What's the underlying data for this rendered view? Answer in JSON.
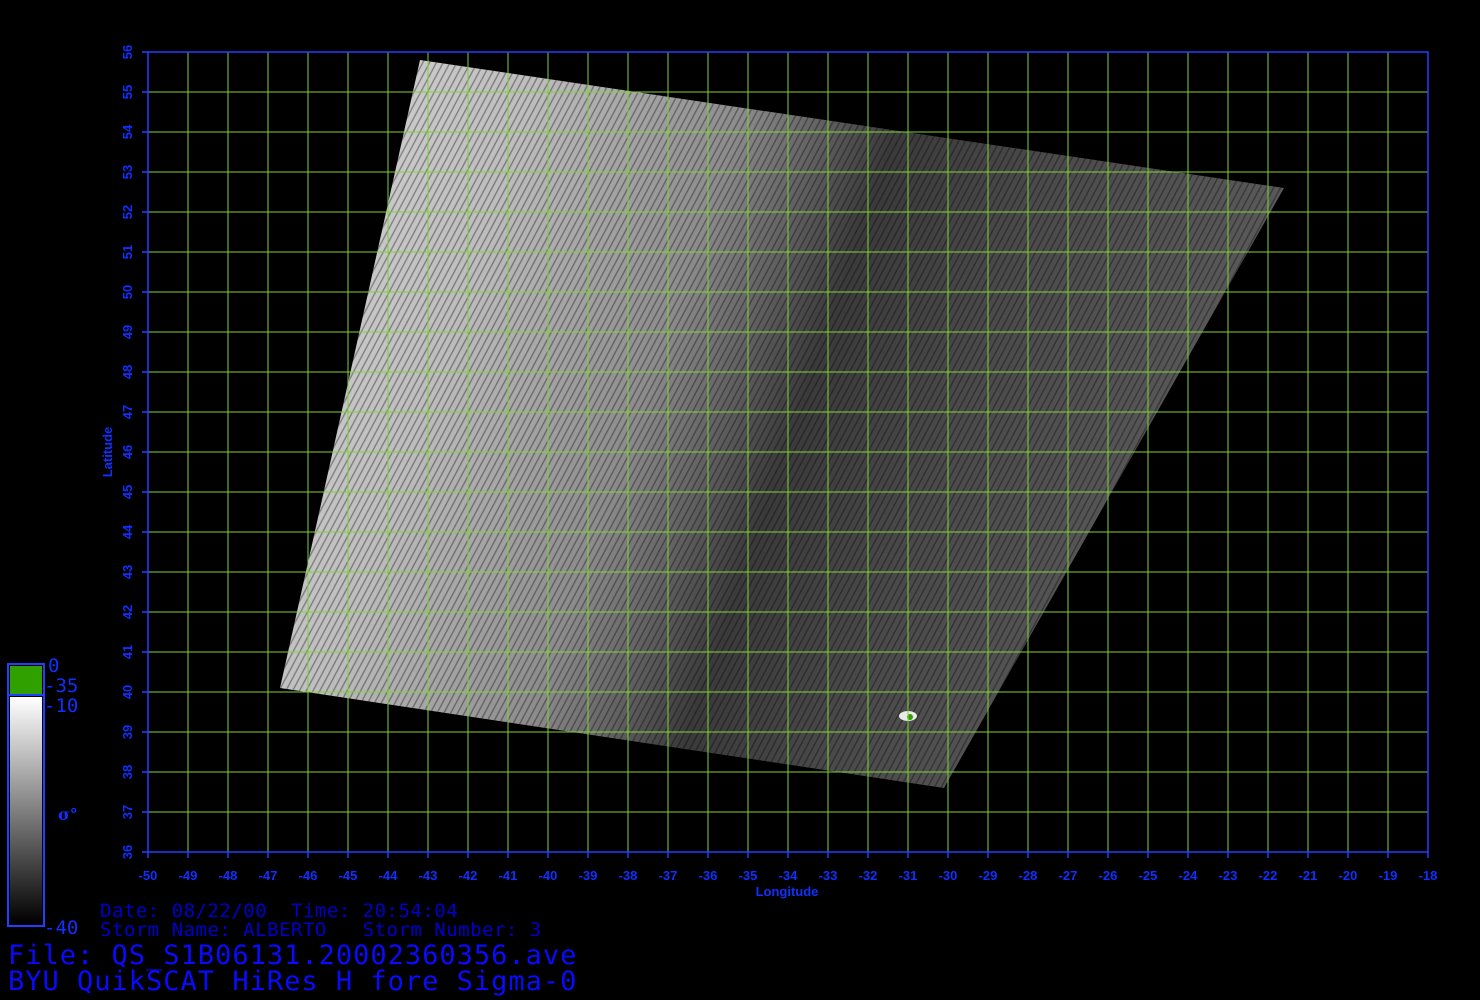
{
  "axes": {
    "x_label": "Longitude",
    "y_label": "Latitude",
    "x_range": [
      -50,
      -18
    ],
    "y_range": [
      36,
      56
    ],
    "x_ticks": [
      "-50",
      "-49",
      "-48",
      "-47",
      "-46",
      "-45",
      "-44",
      "-43",
      "-42",
      "-41",
      "-40",
      "-39",
      "-38",
      "-37",
      "-36",
      "-35",
      "-34",
      "-33",
      "-32",
      "-31",
      "-30",
      "-29",
      "-28",
      "-27",
      "-26",
      "-25",
      "-24",
      "-23",
      "-22",
      "-21",
      "-20",
      "-19",
      "-18"
    ],
    "y_ticks": [
      "36",
      "37",
      "38",
      "39",
      "40",
      "41",
      "42",
      "43",
      "44",
      "45",
      "46",
      "47",
      "48",
      "49",
      "50",
      "51",
      "52",
      "53",
      "54",
      "55",
      "56"
    ],
    "grid": true,
    "frame_color": "#2040ff",
    "grid_color": "#7fd23a"
  },
  "swath": {
    "corners_lonlat": [
      [
        -43.2,
        55.8
      ],
      [
        -21.6,
        52.6
      ],
      [
        -30.1,
        37.6
      ],
      [
        -46.7,
        40.1
      ]
    ],
    "description_colors": {
      "bright": "#e0e0e0",
      "dark": "#1a1a1a"
    },
    "highlight_lonlat": [
      -31.0,
      39.4
    ]
  },
  "colorbar": {
    "labels": {
      "top": "0",
      "upper": "-35",
      "mid": "-10",
      "bottom": "-40"
    },
    "unit": "σ°",
    "colors": {
      "green": "#2fa000",
      "white": "#ffffff",
      "black": "#000000"
    }
  },
  "meta": {
    "date_line": "Date: 08/22/00  Time: 20:54:04",
    "storm_line": "Storm Name: ALBERTO   Storm Number: 3",
    "file_line": "File: QS_S1B06131.20002360356.ave",
    "title_line": "BYU QuikSCAT HiRes H fore Sigma-0"
  }
}
